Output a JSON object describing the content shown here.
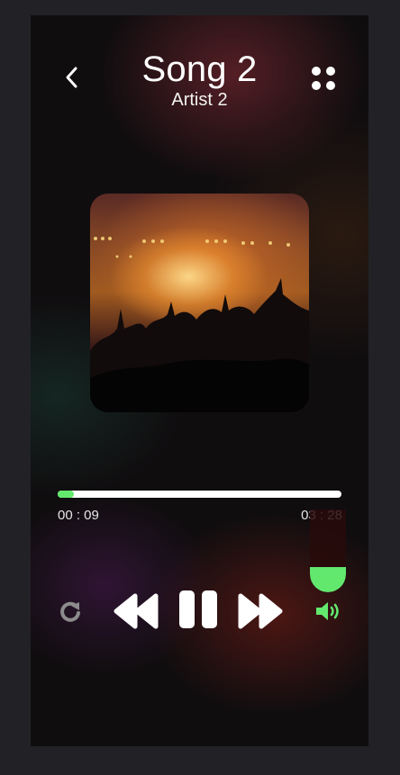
{
  "player": {
    "song_title": "Song 2",
    "artist": "Artist 2",
    "current_time": "00 : 09",
    "total_time": "03 : 28",
    "progress_fraction": 0.057,
    "volume_fraction": 0.3
  },
  "icons": {
    "back": "chevron-left-icon",
    "menu": "grid-dots-icon",
    "repeat": "repeat-icon",
    "rewind": "rewind-icon",
    "pause": "pause-icon",
    "fast_forward": "fast-forward-icon",
    "volume": "volume-icon"
  },
  "colors": {
    "accent": "#63e86e",
    "text": "#ffffff",
    "muted_icon": "#8c8c8c"
  }
}
